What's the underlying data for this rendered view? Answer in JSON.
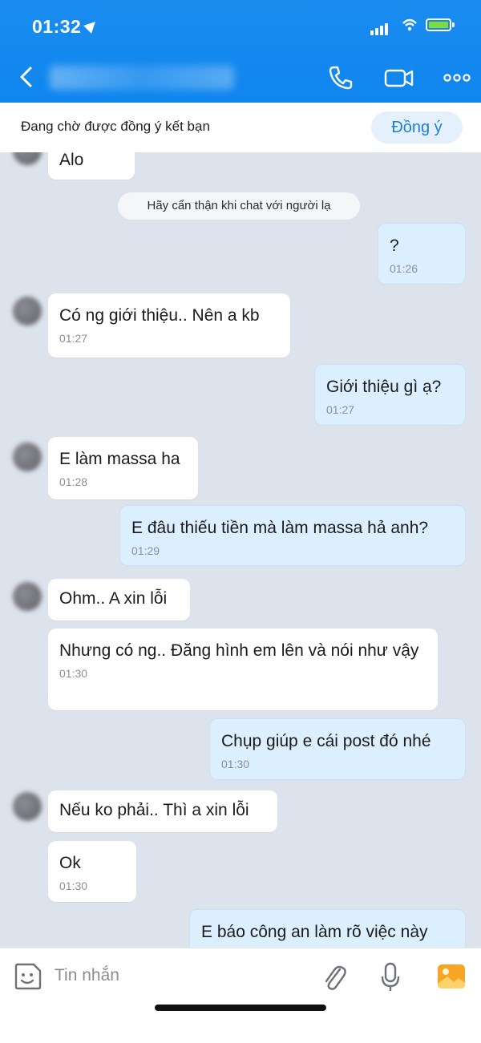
{
  "status": {
    "time": "01:32"
  },
  "header": {
    "contact_name": ""
  },
  "friend_request": {
    "text": "Đang chờ được đồng ý kết bạn",
    "accept_label": "Đồng ý"
  },
  "notice": "Hãy cẩn thận khi chat với người lạ",
  "messages": [
    {
      "dir": "recv",
      "text": "Alo",
      "time": ""
    },
    {
      "dir": "sent",
      "text": "?",
      "time": "01:26"
    },
    {
      "dir": "recv",
      "text": "Có ng giới thiệu.. Nên a kb",
      "time": "01:27"
    },
    {
      "dir": "sent",
      "text": "Giới thiệu gì ạ?",
      "time": "01:27"
    },
    {
      "dir": "recv",
      "text": "E làm massa ha",
      "time": "01:28"
    },
    {
      "dir": "sent",
      "text": "E đâu thiếu tiền mà làm massa hả anh?",
      "time": "01:29"
    },
    {
      "dir": "recv",
      "text": "Ohm.. A xin lỗi",
      "time": ""
    },
    {
      "dir": "recv",
      "text": "Nhưng có ng.. Đăng hình em lên và nói như vậy",
      "time": "01:30"
    },
    {
      "dir": "sent",
      "text": "Chụp giúp e cái post đó nhé",
      "time": "01:30"
    },
    {
      "dir": "recv",
      "text": "Nếu ko phải.. Thì a xin lỗi",
      "time": ""
    },
    {
      "dir": "recv",
      "text": "Ok",
      "time": "01:30"
    },
    {
      "dir": "sent",
      "text": "E báo công an làm rõ việc này",
      "time": ""
    }
  ],
  "input": {
    "placeholder": "Tin nhắn"
  },
  "colors": {
    "header": "#1a8cf0",
    "sent_bubble": "#dcefff",
    "recv_bubble": "#ffffff",
    "chat_bg": "#dde3ec",
    "accent": "#1e7fdd"
  },
  "icons": [
    "back-arrow-icon",
    "phone-icon",
    "video-call-icon",
    "more-options-icon",
    "sticker-icon",
    "attachment-icon",
    "microphone-icon",
    "image-icon"
  ]
}
